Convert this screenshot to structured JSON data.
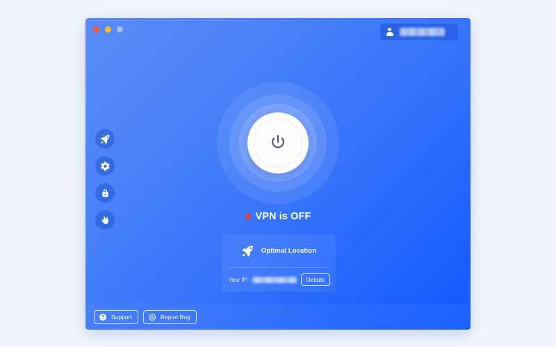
{
  "page": {
    "background_color": "#f1f5fc"
  },
  "window": {
    "gradient_from": "#5b8cf5",
    "gradient_to": "#1259ff",
    "traffic_lights": [
      {
        "name": "close",
        "color": "#f9544b"
      },
      {
        "name": "minimize",
        "color": "#f9bc2e"
      },
      {
        "name": "maximize",
        "color": "#a9bcd6"
      }
    ]
  },
  "account": {
    "icon": "user-icon",
    "username": "█████████",
    "username_redacted": true,
    "badge_color": "#2c62e8"
  },
  "sidebar": {
    "items": [
      {
        "icon": "rocket-icon",
        "name": "speed"
      },
      {
        "icon": "gear-icon",
        "name": "settings"
      },
      {
        "icon": "lock-icon",
        "name": "security"
      },
      {
        "icon": "hand-icon",
        "name": "block"
      }
    ]
  },
  "connection": {
    "power_button_icon": "power-icon",
    "status_text": "VPN is OFF",
    "status_indicator_color": "#f5372b",
    "connected": false
  },
  "location_card": {
    "icon": "rocket-icon",
    "title": "Optimal Location",
    "ip_label": "Your IP:",
    "ip_value": "███.██.███.██",
    "ip_redacted": true,
    "details_label": "Details"
  },
  "bottom_bar": {
    "buttons": [
      {
        "icon": "question-circle-icon",
        "label": "Support"
      },
      {
        "icon": "bug-target-icon",
        "label": "Report Bug"
      }
    ]
  }
}
